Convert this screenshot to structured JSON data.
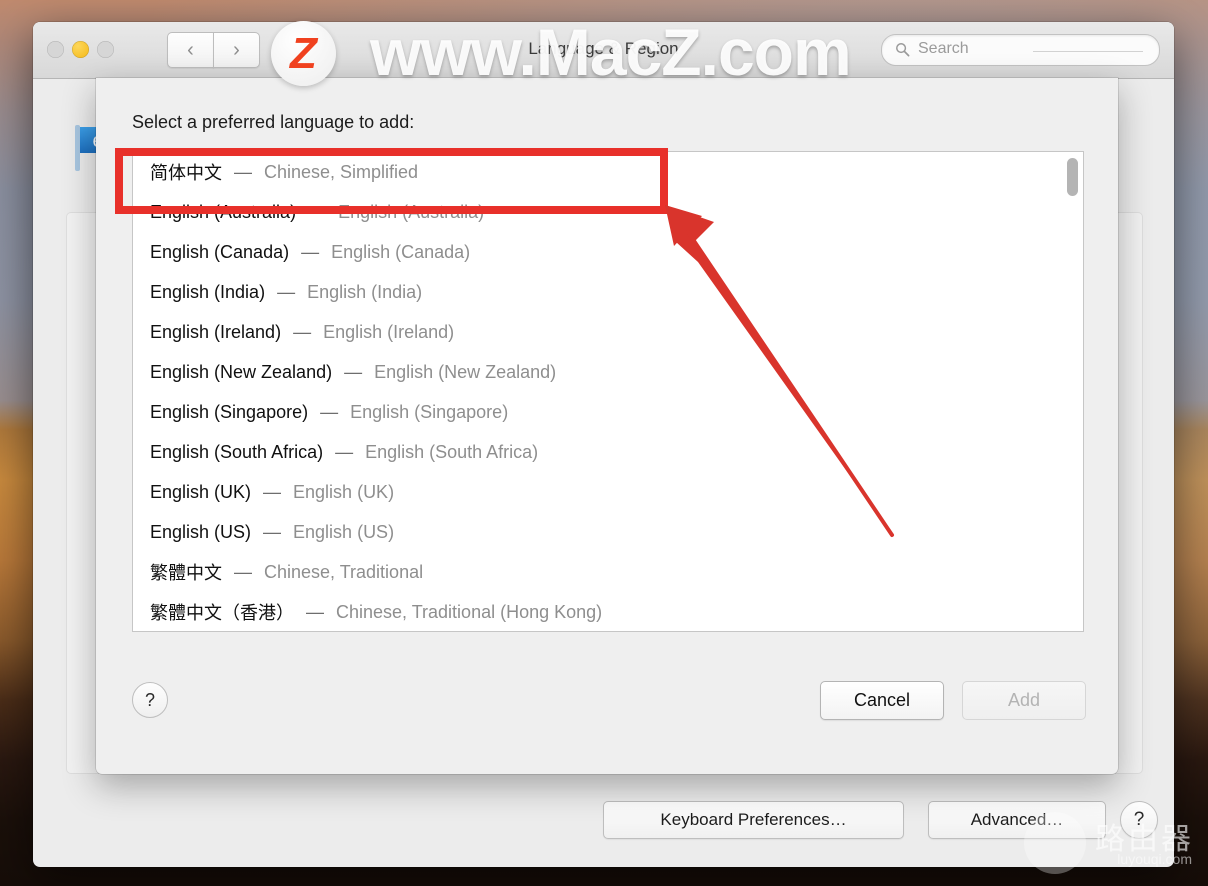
{
  "window": {
    "title": "Language & Region",
    "traffic_lights": [
      "close",
      "minimize",
      "zoom"
    ],
    "nav_back": "‹",
    "nav_forward": "›"
  },
  "search": {
    "placeholder": "Search"
  },
  "sheet": {
    "label": "Select a preferred language to add:",
    "help_label": "?",
    "cancel_label": "Cancel",
    "add_label": "Add",
    "languages": [
      {
        "native": "简体中文",
        "dash": "—",
        "english": "Chinese, Simplified",
        "selected": true
      },
      {
        "native": "English (Australia)",
        "dash": "—",
        "english": "English (Australia)",
        "selected": false
      },
      {
        "native": "English (Canada)",
        "dash": "—",
        "english": "English (Canada)",
        "selected": false
      },
      {
        "native": "English (India)",
        "dash": "—",
        "english": "English (India)",
        "selected": false
      },
      {
        "native": "English (Ireland)",
        "dash": "—",
        "english": "English (Ireland)",
        "selected": false
      },
      {
        "native": "English (New Zealand)",
        "dash": "—",
        "english": "English (New Zealand)",
        "selected": false
      },
      {
        "native": "English (Singapore)",
        "dash": "—",
        "english": "English (Singapore)",
        "selected": false
      },
      {
        "native": "English (South Africa)",
        "dash": "—",
        "english": "English (South Africa)",
        "selected": false
      },
      {
        "native": "English (UK)",
        "dash": "—",
        "english": "English (UK)",
        "selected": false
      },
      {
        "native": "English (US)",
        "dash": "—",
        "english": "English (US)",
        "selected": false
      },
      {
        "native": "繁體中文",
        "dash": "—",
        "english": "Chinese, Traditional",
        "selected": false
      },
      {
        "native": "繁體中文（香港）",
        "dash": "—",
        "english": "Chinese, Traditional (Hong Kong)",
        "selected": false
      }
    ]
  },
  "toolbar": {
    "keyboard_prefs_label": "Keyboard Preferences…",
    "advanced_label": "Advanced…",
    "help_label": "?"
  },
  "watermarks": {
    "macz": "www.MacZ.com",
    "macz_badge": "Z",
    "router_cn": "路由器",
    "router_en": "luyouqi.com"
  },
  "colors": {
    "annotation_red": "#e8302a",
    "badge_orange": "#f0411f",
    "minimize_yellow": "#f4b816"
  }
}
